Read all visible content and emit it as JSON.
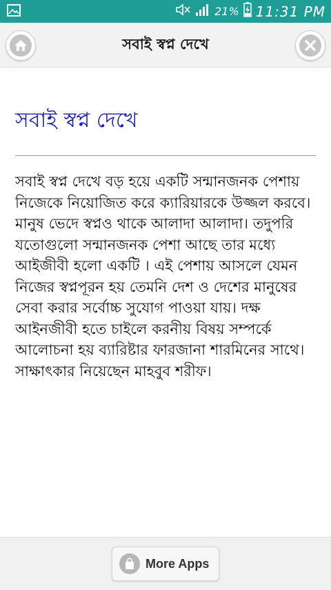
{
  "status_bar": {
    "battery_percent": "21%",
    "time": "11:31 PM",
    "icons": [
      "image-icon",
      "mute-icon",
      "signal-icon",
      "battery-charging-icon"
    ]
  },
  "header": {
    "title": "সবাই স্বপ্ন দেখে",
    "home_icon": "home-icon",
    "close_icon": "close-icon"
  },
  "article": {
    "heading": "সবাই স্বপ্ন দেখে",
    "body": "সবাই স্বপ্ন দেখে বড় হয়ে একটি সন্মানজনক পেশায় নিজেকে নিয়োজিত করে ক্যারিয়ারকে উজ্জল করবে। মানুষ ভেদে স্বপ্নও থাকে আলাদা আলাদা। তদুপরি যতোগুলো সন্মানজনক পেশা আছে তার মধ্যে আইজীবী হলো একটি । এই পেশায় আসলে যেমন নিজের স্বপ্নপূরন হয় তেমনি দেশ ও দেশের মানুষের সেবা করার সর্বোচ্চ সুযোগ পাওয়া যায়। দক্ষ আইনজীবী হতে চাইলে করনীয় বিষয় সম্পর্কে আলোচনা হয় ব্যারিষ্টার ফারজানা শারমিনের সাথে। সাক্ষাৎকার নিয়েছেন মাহবুব শরীফ।"
  },
  "footer": {
    "more_apps_label": "More Apps",
    "more_apps_icon": "shopping-bag-icon"
  },
  "colors": {
    "status_bar_bg": "#1e9e96",
    "heading_color": "#1c1ca8",
    "header_bg": "#f2f2f2"
  }
}
